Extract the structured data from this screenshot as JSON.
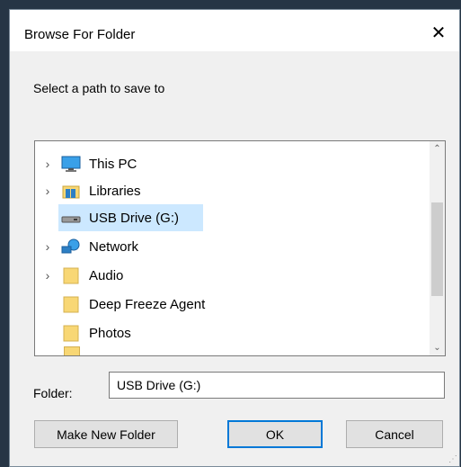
{
  "dialog": {
    "title": "Browse For Folder",
    "close_icon": "close-icon",
    "prompt": "Select a path to save to"
  },
  "tree": {
    "items": [
      {
        "label": "This PC",
        "icon": "computer-icon",
        "expandable": true,
        "selected": false
      },
      {
        "label": "Libraries",
        "icon": "libraries-icon",
        "expandable": true,
        "selected": false
      },
      {
        "label": "USB Drive (G:)",
        "icon": "usb-drive-icon",
        "expandable": false,
        "selected": true
      },
      {
        "label": "Network",
        "icon": "network-icon",
        "expandable": true,
        "selected": false
      },
      {
        "label": "Audio",
        "icon": "folder-icon",
        "expandable": true,
        "selected": false
      },
      {
        "label": "Deep Freeze Agent",
        "icon": "folder-icon",
        "expandable": false,
        "selected": false
      },
      {
        "label": "Photos",
        "icon": "folder-icon",
        "expandable": false,
        "selected": false
      }
    ],
    "chevron_glyph": "›",
    "scroll_up_glyph": "⌃",
    "scroll_down_glyph": "⌄"
  },
  "folder": {
    "label": "Folder:",
    "value": "USB Drive (G:)"
  },
  "buttons": {
    "make_new_folder": "Make New Folder",
    "ok": "OK",
    "cancel": "Cancel"
  },
  "colors": {
    "selection": "#cce8ff",
    "accent": "#0078d7",
    "folder_yellow": "#f8d775"
  }
}
